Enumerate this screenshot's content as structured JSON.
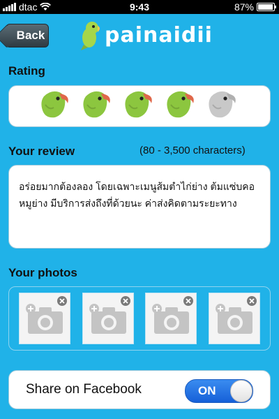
{
  "status_bar": {
    "carrier": "dtac",
    "time": "9:43",
    "battery_text": "87%",
    "battery_level": 0.87
  },
  "nav": {
    "back_label": "Back",
    "logo_text": "painaidii"
  },
  "rating": {
    "label": "Rating",
    "value": 4,
    "max": 5
  },
  "review": {
    "label": "Your review",
    "hint": "(80 - 3,500 characters)",
    "text": "อร่อยมากต้องลอง โดยเฉพาะเมนูส้มตำไก่ย่าง ต้มแซ่บคอหมูย่าง มีบริการส่งถึงที่ด้วยนะ ค่าส่งคิดตามระยะทาง"
  },
  "photos": {
    "label": "Your photos",
    "slots": 4
  },
  "facebook": {
    "label": "Share on Facebook",
    "toggle_text": "ON",
    "enabled": true
  },
  "colors": {
    "background": "#20b2e8",
    "parrot_green": "#8cc63f",
    "parrot_beak": "#e0674a",
    "parrot_empty": "#c8c8c8",
    "toggle_on": "#1f6fe0"
  }
}
